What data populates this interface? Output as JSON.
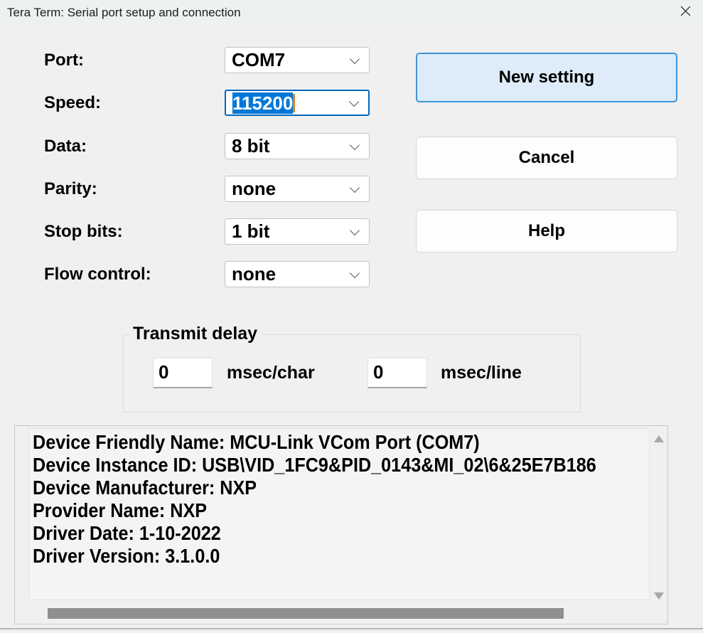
{
  "window": {
    "title": "Tera Term: Serial port setup and connection"
  },
  "icons": {
    "close": "x-close",
    "dropdown": "chevron-down",
    "scroll_up": "triangle-up",
    "scroll_down": "triangle-down"
  },
  "colors": {
    "titlebar_bg": "#ecf3ee",
    "dialog_bg": "#f0f0f0",
    "focus_border_blue": "#0067c0",
    "selection_blue": "#0078d7",
    "caret_orange": "#d9822b",
    "primary_button_bg": "#ddecf8",
    "primary_button_border": "#3c95d8",
    "scrollbar_thumb": "#8f8f8f"
  },
  "fields": [
    {
      "id": "port",
      "label": "Port:",
      "value": "COM7"
    },
    {
      "id": "speed",
      "label": "Speed:",
      "value": "115200",
      "focused": true,
      "selected": true
    },
    {
      "id": "data",
      "label": "Data:",
      "value": "8 bit"
    },
    {
      "id": "parity",
      "label": "Parity:",
      "value": "none"
    },
    {
      "id": "stop_bits",
      "label": "Stop bits:",
      "value": "1 bit"
    },
    {
      "id": "flow_control",
      "label": "Flow control:",
      "value": "none"
    }
  ],
  "buttons": {
    "new_setting": "New setting",
    "cancel": "Cancel",
    "help": "Help"
  },
  "transmit_delay": {
    "title": "Transmit delay",
    "char_value": "0",
    "char_unit": "msec/char",
    "line_value": "0",
    "line_unit": "msec/line"
  },
  "device_info": {
    "lines": [
      "Device Friendly Name: MCU-Link VCom Port (COM7)",
      "Device Instance ID: USB\\VID_1FC9&PID_0143&MI_02\\6&25E7B186",
      "Device Manufacturer: NXP",
      "Provider Name: NXP",
      "Driver Date: 1-10-2022",
      "Driver Version: 3.1.0.0"
    ]
  }
}
